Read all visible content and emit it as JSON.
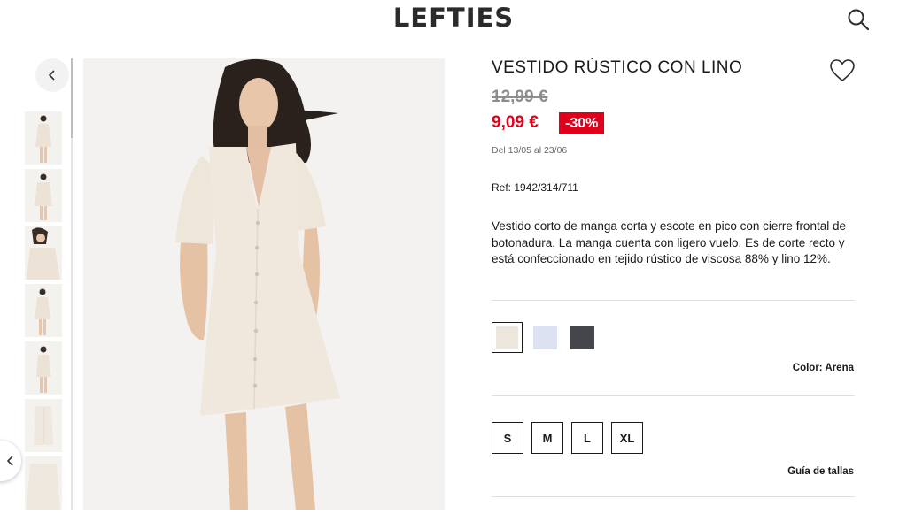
{
  "header": {
    "logo": "LEFTIES",
    "search_icon": "search-icon"
  },
  "gallery": {
    "prev_icon": "chevron-left-icon",
    "thumbnail_count": 7,
    "main_image": "model-wearing-cream-dress"
  },
  "product": {
    "title": "VESTIDO RÚSTICO CON LINO",
    "old_price": "12,99 €",
    "new_price": "9,09 €",
    "discount": "-30%",
    "dates": "Del 13/05 al 23/06",
    "reference": "Ref: 1942/314/711",
    "description": "Vestido corto de manga corta y escote en pico con cierre frontal de botonadura. La manga cuenta con ligero vuelo. Es de corte recto y está confeccionado en tejido rústico de viscosa 88% y lino 12%.",
    "favorite_icon": "heart-icon"
  },
  "colors": {
    "swatches": [
      {
        "name": "Arena",
        "hex": "#ede6dc",
        "selected": true
      },
      {
        "name": "",
        "hex": "#dde2f3",
        "selected": false
      },
      {
        "name": "",
        "hex": "#45464b",
        "selected": false
      }
    ],
    "label": "Color: Arena"
  },
  "sizes": {
    "options": [
      "S",
      "M",
      "L",
      "XL"
    ],
    "guide_label": "Guía de tallas"
  },
  "theme": {
    "accent_red": "#e0001b",
    "text": "#1a1a1a",
    "muted": "#8d8d8d"
  }
}
